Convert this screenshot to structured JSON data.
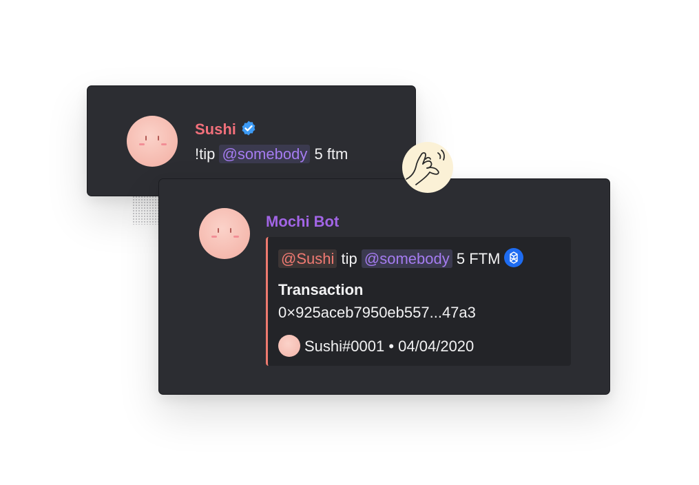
{
  "colors": {
    "card_bg": "#2c2d32",
    "embed_bg": "#232428",
    "user_name": "#f2707b",
    "bot_name": "#a265e6",
    "mention": "#a57cf1",
    "embed_accent": "#ef7a6f",
    "verified": "#3d9bf6",
    "fantom": "#1e6cf1"
  },
  "user_message": {
    "author": "Sushi",
    "verified_icon": "verified-badge-icon",
    "command": "!tip",
    "mention": "@somebody",
    "amount": "5 ftm"
  },
  "reaction": {
    "icon": "call-me-hand-icon"
  },
  "bot_message": {
    "author": "Mochi Bot",
    "embed": {
      "sender_mention": "@Sushi",
      "verb": "tip",
      "recipient_mention": "@somebody",
      "amount": "5 FTM",
      "token_icon": "fantom-token-icon",
      "transaction_label": "Transaction",
      "transaction_hash": "0×925aceb7950eb557...47a3",
      "footer_user": "Sushi#0001",
      "footer_separator": "•",
      "footer_date": "04/04/2020"
    }
  }
}
